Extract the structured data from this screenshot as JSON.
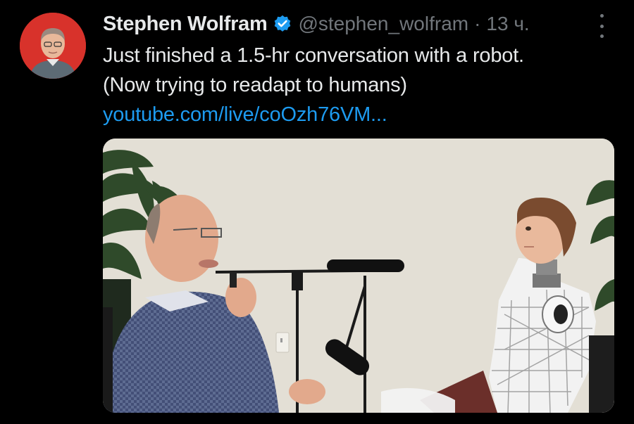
{
  "tweet": {
    "author_name": "Stephen Wolfram",
    "handle": "@stephen_wolfram",
    "separator": "·",
    "time": "13 ч.",
    "verified": true,
    "text_lines": [
      "Just finished a 1.5-hr conversation with a robot.",
      "(Now trying to readapt to humans)"
    ],
    "link_text": "youtube.com/live/coOzh76VM...",
    "icons": {
      "verified": "verified-badge-icon",
      "more": "more-options-icon"
    },
    "colors": {
      "background": "#000000",
      "primary_text": "#e7e9ea",
      "secondary_text": "#71767b",
      "link": "#1d9bf0",
      "verified": "#1d9bf0"
    }
  }
}
